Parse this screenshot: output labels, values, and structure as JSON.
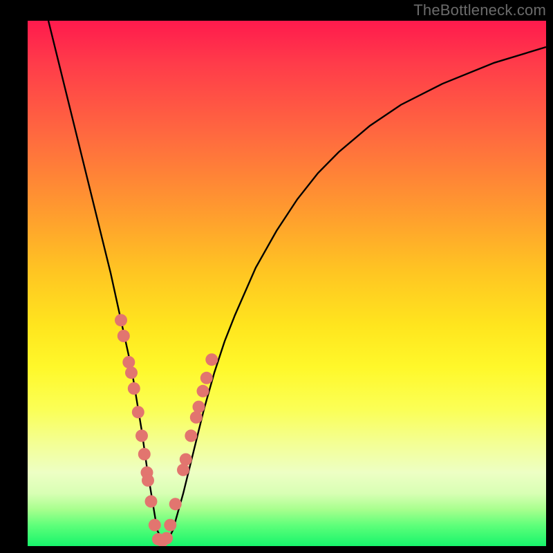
{
  "watermark": "TheBottleneck.com",
  "chart_data": {
    "type": "line",
    "title": "",
    "xlabel": "",
    "ylabel": "",
    "xlim": [
      0,
      100
    ],
    "ylim": [
      0,
      100
    ],
    "series": [
      {
        "name": "curve",
        "x": [
          4,
          6,
          8,
          10,
          12,
          14,
          16,
          18,
          20,
          22,
          23,
          24,
          25,
          26,
          27,
          28,
          30,
          32,
          34,
          36,
          38,
          40,
          44,
          48,
          52,
          56,
          60,
          66,
          72,
          80,
          90,
          100
        ],
        "values": [
          100,
          92,
          84,
          76,
          68,
          60,
          52,
          43,
          34,
          22,
          15,
          9,
          3,
          1,
          1,
          3,
          10,
          18,
          26,
          33,
          39,
          44,
          53,
          60,
          66,
          71,
          75,
          80,
          84,
          88,
          92,
          95
        ]
      }
    ],
    "minimum_x": 25.5,
    "data_points": {
      "note": "pink sample dots along the curve near the minimum",
      "x": [
        18.0,
        18.5,
        19.5,
        20.0,
        20.5,
        21.3,
        22.0,
        22.5,
        23.0,
        23.2,
        23.8,
        24.5,
        25.2,
        26.0,
        26.8,
        27.5,
        28.5,
        30.0,
        30.5,
        31.5,
        32.5,
        33.0,
        33.8,
        34.5,
        35.5
      ],
      "values": [
        43.0,
        40.0,
        35.0,
        33.0,
        30.0,
        25.5,
        21.0,
        17.5,
        14.0,
        12.5,
        8.5,
        4.0,
        1.3,
        1.0,
        1.5,
        4.0,
        8.0,
        14.5,
        16.5,
        21.0,
        24.5,
        26.5,
        29.5,
        32.0,
        35.5
      ]
    },
    "gradient_stops": [
      {
        "pos": 0.0,
        "color": "#ff1a4d"
      },
      {
        "pos": 0.35,
        "color": "#ff9a2f"
      },
      {
        "pos": 0.6,
        "color": "#ffe51e"
      },
      {
        "pos": 0.85,
        "color": "#edffc4"
      },
      {
        "pos": 1.0,
        "color": "#17f56b"
      }
    ]
  }
}
